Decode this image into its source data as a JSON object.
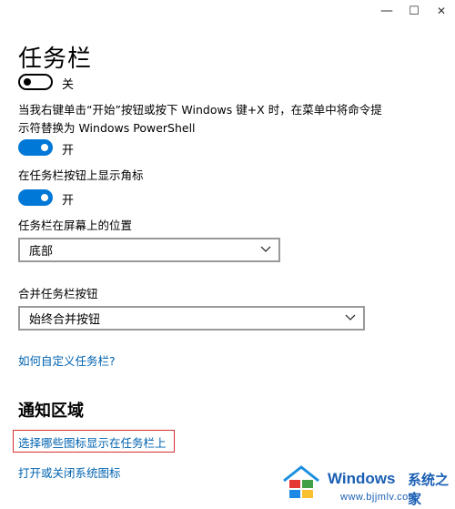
{
  "window": {
    "minimize_glyph": "—",
    "maximize_glyph": "☐",
    "close_glyph": "✕"
  },
  "page": {
    "title": "任务栏"
  },
  "settings": {
    "top_toggle": {
      "state_label": "关",
      "on": false
    },
    "powershell": {
      "line1": "当我右键单击“开始”按钮或按下 Windows 键+X 时，在菜单中将命令提",
      "line2": "示符替换为 Windows PowerShell",
      "state_label": "开",
      "on": true
    },
    "badges": {
      "label": "在任务栏按钮上显示角标",
      "state_label": "开",
      "on": true
    },
    "location": {
      "label": "任务栏在屏幕上的位置",
      "value": "底部"
    },
    "combine": {
      "label": "合并任务栏按钮",
      "value": "始终合并按钮"
    },
    "customize_link": "如何自定义任务栏?"
  },
  "notification_area": {
    "title": "通知区域",
    "select_icons_link": "选择哪些图标显示在任务栏上",
    "system_icons_link": "打开或关闭系统图标"
  },
  "watermark": {
    "title": "Windows",
    "title_cn": "系统之家",
    "url": "www.bjjmlv.com"
  },
  "colors": {
    "accent": "#0078d7",
    "link": "#0063b1",
    "highlight": "#d32f2f"
  }
}
